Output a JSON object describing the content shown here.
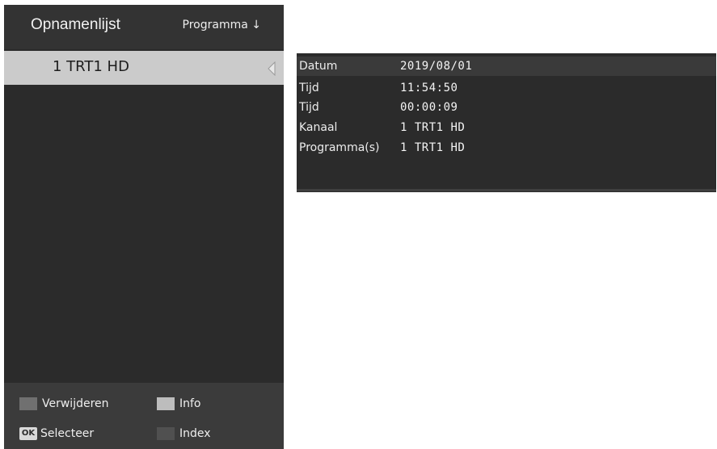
{
  "recordings": {
    "title": "Opnamenlijst",
    "sort_label": "Programma ↓",
    "items": [
      {
        "label": "1 TRT1 HD"
      }
    ],
    "footer": {
      "delete_label": "Verwijderen",
      "info_label": "Info",
      "ok_key": "OK",
      "select_label": "Selecteer",
      "index_label": "Index"
    }
  },
  "info": {
    "rows": [
      {
        "key": "Datum",
        "value": "2019/08/01"
      },
      {
        "key": "Tijd",
        "value": "11:54:50"
      },
      {
        "key": "Tijd",
        "value": "00:00:09"
      },
      {
        "key": "Kanaal",
        "value": "1 TRT1 HD"
      },
      {
        "key": "Programma(s)",
        "value": "1 TRT1 HD"
      }
    ]
  },
  "colors": {
    "panel_bg": "#2b2b2b",
    "selected_item_bg": "#cbcbcb",
    "delete_swatch": "#707070",
    "info_swatch": "#bdbdbd",
    "index_swatch": "#505050"
  },
  "icons": {
    "item_arrow": "chevron-left-icon"
  }
}
